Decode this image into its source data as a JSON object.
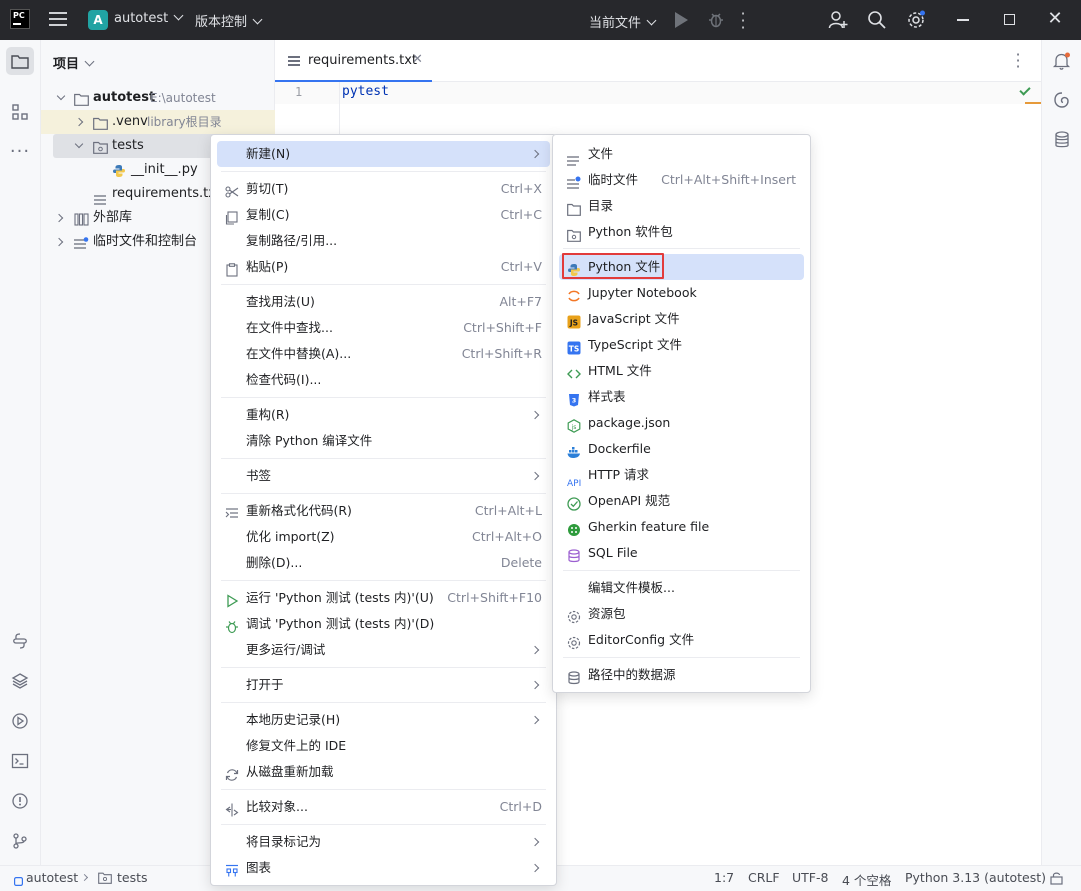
{
  "titlebar": {
    "app_logo": "PC",
    "project_badge": "A",
    "project_name": "autotest",
    "vcs_label": "版本控制",
    "current_file_label": "当前文件"
  },
  "project_panel": {
    "title": "项目",
    "tree": [
      {
        "label": "autotest",
        "path": "E:\\autotest"
      },
      {
        "label": ".venv",
        "note": "library根目录"
      },
      {
        "label": "tests"
      },
      {
        "label": "__init__.py"
      },
      {
        "label": "requirements.txt"
      },
      {
        "label": "外部库"
      },
      {
        "label": "临时文件和控制台"
      }
    ]
  },
  "editor": {
    "tab_label": "requirements.txt",
    "line_number": "1",
    "code_line": "pytest"
  },
  "context_menu": {
    "items": [
      {
        "label": "新建(N)",
        "shortcut": ""
      },
      {
        "label": "剪切(T)",
        "shortcut": "Ctrl+X"
      },
      {
        "label": "复制(C)",
        "shortcut": "Ctrl+C"
      },
      {
        "label": "复制路径/引用...",
        "shortcut": ""
      },
      {
        "label": "粘贴(P)",
        "shortcut": "Ctrl+V"
      },
      {
        "label": "查找用法(U)",
        "shortcut": "Alt+F7"
      },
      {
        "label": "在文件中查找...",
        "shortcut": "Ctrl+Shift+F"
      },
      {
        "label": "在文件中替换(A)...",
        "shortcut": "Ctrl+Shift+R"
      },
      {
        "label": "检查代码(I)...",
        "shortcut": ""
      },
      {
        "label": "重构(R)",
        "shortcut": ""
      },
      {
        "label": "清除 Python 编译文件",
        "shortcut": ""
      },
      {
        "label": "书签",
        "shortcut": ""
      },
      {
        "label": "重新格式化代码(R)",
        "shortcut": "Ctrl+Alt+L"
      },
      {
        "label": "优化 import(Z)",
        "shortcut": "Ctrl+Alt+O"
      },
      {
        "label": "删除(D)...",
        "shortcut": "Delete"
      },
      {
        "label": "运行 'Python 测试 (tests 内)'(U)",
        "shortcut": "Ctrl+Shift+F10"
      },
      {
        "label": "调试 'Python 测试 (tests 内)'(D)",
        "shortcut": ""
      },
      {
        "label": "更多运行/调试",
        "shortcut": ""
      },
      {
        "label": "打开于",
        "shortcut": ""
      },
      {
        "label": "本地历史记录(H)",
        "shortcut": ""
      },
      {
        "label": "修复文件上的 IDE",
        "shortcut": ""
      },
      {
        "label": "从磁盘重新加载",
        "shortcut": ""
      },
      {
        "label": "比较对象...",
        "shortcut": "Ctrl+D"
      },
      {
        "label": "将目录标记为",
        "shortcut": ""
      },
      {
        "label": "图表",
        "shortcut": ""
      }
    ]
  },
  "new_submenu": {
    "items": [
      {
        "label": "文件",
        "shortcut": ""
      },
      {
        "label": "临时文件",
        "shortcut": "Ctrl+Alt+Shift+Insert"
      },
      {
        "label": "目录",
        "shortcut": ""
      },
      {
        "label": "Python 软件包",
        "shortcut": ""
      },
      {
        "label": "Python 文件",
        "shortcut": ""
      },
      {
        "label": "Jupyter Notebook",
        "shortcut": ""
      },
      {
        "label": "JavaScript 文件",
        "shortcut": ""
      },
      {
        "label": "TypeScript 文件",
        "shortcut": ""
      },
      {
        "label": "HTML 文件",
        "shortcut": ""
      },
      {
        "label": "样式表",
        "shortcut": ""
      },
      {
        "label": "package.json",
        "shortcut": ""
      },
      {
        "label": "Dockerfile",
        "shortcut": ""
      },
      {
        "label": "HTTP 请求",
        "shortcut": ""
      },
      {
        "label": "OpenAPI 规范",
        "shortcut": ""
      },
      {
        "label": "Gherkin feature file",
        "shortcut": ""
      },
      {
        "label": "SQL File",
        "shortcut": ""
      },
      {
        "label": "编辑文件模板...",
        "shortcut": ""
      },
      {
        "label": "资源包",
        "shortcut": ""
      },
      {
        "label": "EditorConfig 文件",
        "shortcut": ""
      },
      {
        "label": "路径中的数据源",
        "shortcut": ""
      }
    ]
  },
  "statusbar": {
    "crumb_project": "autotest",
    "crumb_folder": "tests",
    "position": "1:7",
    "line_sep": "CRLF",
    "encoding": "UTF-8",
    "indent": "4 个空格",
    "interpreter": "Python 3.13 (autotest)"
  },
  "colors": {
    "accent": "#3574f0",
    "highlight": "#d5e1fa",
    "titlebar": "#27282c",
    "red_box": "#e23b3b"
  }
}
